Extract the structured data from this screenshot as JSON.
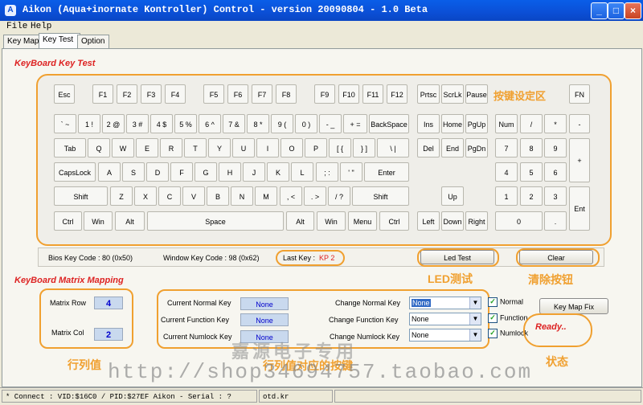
{
  "window": {
    "title": "Aikon (Aqua+inornate Kontroller) Control - version 20090804 - 1.0 Beta",
    "app_icon": "A",
    "minimize": "_",
    "maximize": "□",
    "close": "×"
  },
  "menu": {
    "file": "File",
    "help": "Help"
  },
  "tabs": [
    {
      "label": "Key Map"
    },
    {
      "label": "Key Test"
    },
    {
      "label": "Option"
    }
  ],
  "key_test": {
    "section_title": "KeyBoard Key Test",
    "keys": {
      "esc": "Esc",
      "f1": "F1",
      "f2": "F2",
      "f3": "F3",
      "f4": "F4",
      "f5": "F5",
      "f6": "F6",
      "f7": "F7",
      "f8": "F8",
      "f9": "F9",
      "f10": "F10",
      "f11": "F11",
      "f12": "F12",
      "prtsc": "Prtsc",
      "scrlk": "ScrLk",
      "pause": "Pause",
      "fn": "FN",
      "tilde": "` ~",
      "k1": "1 !",
      "k2": "2 @",
      "k3": "3 #",
      "k4": "4 $",
      "k5": "5 %",
      "k6": "6 ^",
      "k7": "7 &",
      "k8": "8 *",
      "k9": "9 (",
      "k0": "0 )",
      "minus": "- _",
      "equal": "+ =",
      "backspace": "BackSpace",
      "ins": "Ins",
      "home": "Home",
      "pgup": "PgUp",
      "num": "Num",
      "nslash": "/",
      "nstar": "*",
      "nminus": "-",
      "tab": "Tab",
      "q": "Q",
      "w": "W",
      "e": "E",
      "r": "R",
      "t": "T",
      "y": "Y",
      "u": "U",
      "i": "I",
      "o": "O",
      "p": "P",
      "lbracket": "[ {",
      "rbracket": "} ]",
      "backslash": "\\ |",
      "del": "Del",
      "end": "End",
      "pgdn": "PgDn",
      "n7": "7",
      "n8": "8",
      "n9": "9",
      "nplus": "+",
      "capslock": "CapsLock",
      "a": "A",
      "s": "S",
      "d": "D",
      "f": "F",
      "g": "G",
      "h": "H",
      "j": "J",
      "k": "K",
      "l": "L",
      "semicolon": "; :",
      "quote": "' \"",
      "enter": "Enter",
      "n4": "4",
      "n5": "5",
      "n6": "6",
      "lshift": "Shift",
      "z": "Z",
      "x": "X",
      "c": "C",
      "v": "V",
      "b": "B",
      "n": "N",
      "m": "M",
      "comma": ", <",
      "period": ". >",
      "slash": "/ ?",
      "rshift": "Shift",
      "up": "Up",
      "n1": "1",
      "n2": "2",
      "n3": "3",
      "nenter": "Ent",
      "lctrl": "Ctrl",
      "lwin": "Win",
      "lalt": "Alt",
      "space": "Space",
      "ralt": "Alt",
      "rwin": "Win",
      "menu": "Menu",
      "rctrl": "Ctrl",
      "left": "Left",
      "down": "Down",
      "right": "Right",
      "n0": "0",
      "ndot": "."
    },
    "key_area_label": "按键设定区",
    "bios_key_code": "Bios Key Code : 80 (0x50)",
    "window_key_code": "Window Key Code : 98 (0x62)",
    "last_key_label": "Last Key :",
    "last_key_value": "KP 2",
    "led_test_button": "Led Test",
    "clear_button": "Clear",
    "led_test_caption": "LED测试",
    "clear_caption": "清除按钮"
  },
  "matrix": {
    "section_title": "KeyBoard Matrix Mapping",
    "row_label": "Matrix Row",
    "row_value": "4",
    "col_label": "Matrix Col",
    "col_value": "2",
    "current_normal_label": "Current Normal Key",
    "current_normal_value": "None",
    "current_function_label": "Current Function Key",
    "current_function_value": "None",
    "current_numlock_label": "Current Numlock Key",
    "current_numlock_value": "None",
    "change_normal_label": "Change Normal Key",
    "change_normal_value": "None",
    "change_function_label": "Change Function Key",
    "change_function_value": "None",
    "change_numlock_label": "Change Numlock Key",
    "change_numlock_value": "None",
    "normal_check": "Normal",
    "function_check": "Function",
    "numlock_check": "Numlock",
    "keymap_fix_button": "Key Map Fix",
    "ready_text": "Ready..",
    "rowcol_caption": "行列值",
    "key_caption": "行列值对应的按键",
    "status_caption": "状态"
  },
  "statusbar": {
    "connect": "* Connect : VID:$16C0 / PID:$27EF Aikon - Serial : ?",
    "site": "otd.kr"
  },
  "watermark": {
    "shop_name": "嘉源电子专用",
    "url": "http://shop34694757.taobao.com"
  }
}
